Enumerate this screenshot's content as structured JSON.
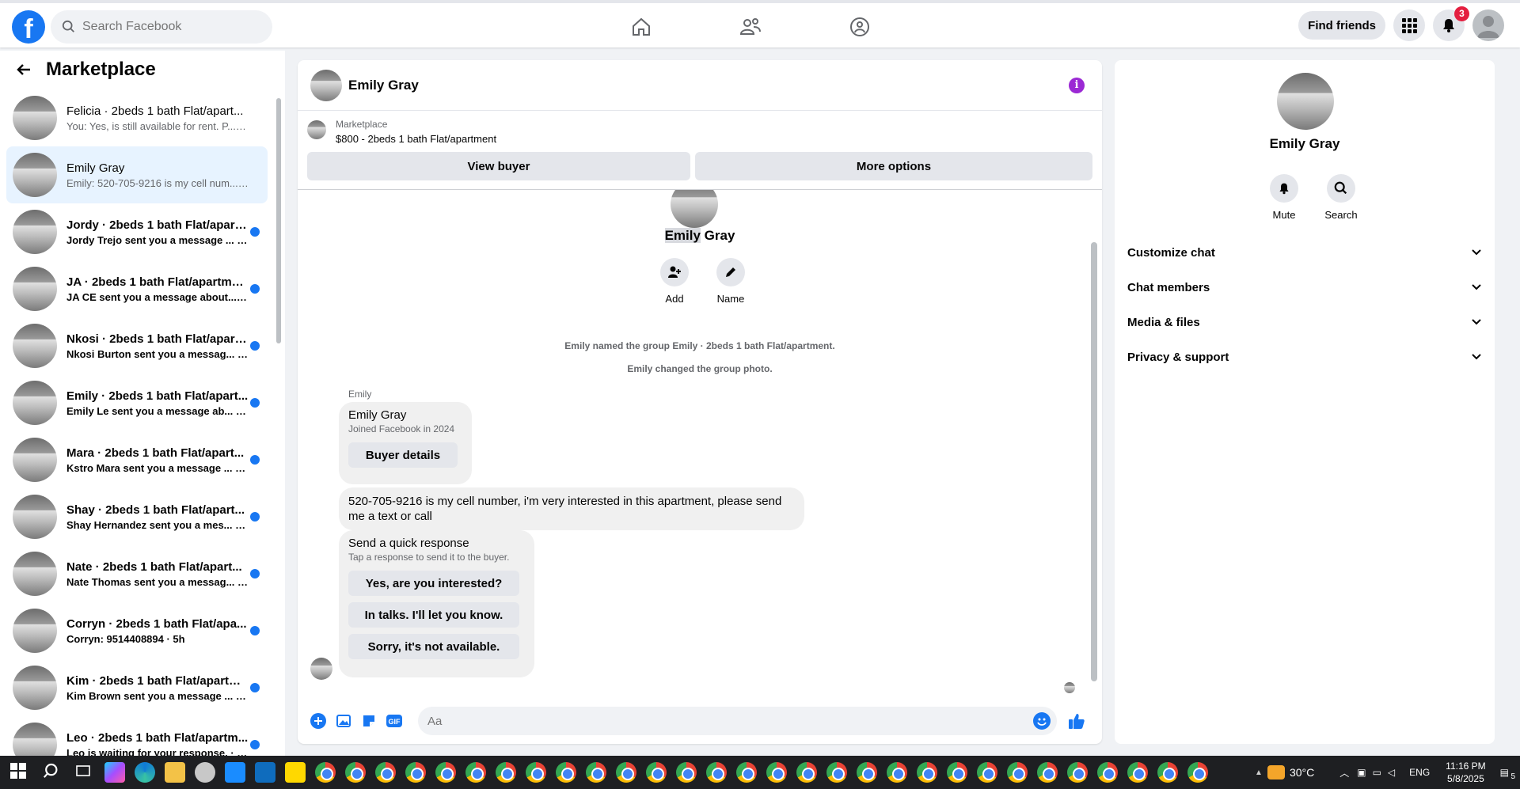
{
  "nav": {
    "search_placeholder": "Search Facebook",
    "find_friends": "Find friends",
    "notifications_count": "3"
  },
  "sidebar": {
    "title": "Marketplace",
    "conversations": [
      {
        "name": "Felicia · 2beds 1 bath Flat/apart...",
        "preview": "You: Yes, is still available for rent. P...",
        "time": "6m",
        "unread": false
      },
      {
        "name": "Emily Gray",
        "preview": "Emily: 520-705-9216 is my cell num...",
        "time": "1h",
        "unread": false
      },
      {
        "name": "Jordy · 2beds 1 bath Flat/apart...",
        "preview": "Jordy Trejo sent you a message ...",
        "time": "2h",
        "unread": true
      },
      {
        "name": "JA · 2beds 1 bath Flat/apartment",
        "preview": "JA CE sent you a message about...",
        "time": "3h",
        "unread": true
      },
      {
        "name": "Nkosi · 2beds 1 bath Flat/apart...",
        "preview": "Nkosi Burton sent you a messag...",
        "time": "3h",
        "unread": true
      },
      {
        "name": "Emily · 2beds 1 bath Flat/apart...",
        "preview": "Emily Le sent you a message ab...",
        "time": "4h",
        "unread": true
      },
      {
        "name": "Mara · 2beds 1 bath Flat/apart...",
        "preview": "Kstro Mara sent you a message ...",
        "time": "4h",
        "unread": true
      },
      {
        "name": "Shay · 2beds 1 bath Flat/apart...",
        "preview": "Shay Hernandez sent you a mes...",
        "time": "4h",
        "unread": true
      },
      {
        "name": "Nate · 2beds 1 bath Flat/apart...",
        "preview": "Nate Thomas sent you a messag...",
        "time": "4h",
        "unread": true
      },
      {
        "name": "Corryn · 2beds 1 bath Flat/apa...",
        "preview": "Corryn: 9514408894",
        "time": "5h",
        "unread": true
      },
      {
        "name": "Kim · 2beds 1 bath Flat/apartm...",
        "preview": "Kim Brown sent you a message ...",
        "time": "5h",
        "unread": true
      },
      {
        "name": "Leo · 2beds 1 bath Flat/apartm...",
        "preview": "Leo is waiting for your response.",
        "time": "6h",
        "unread": true
      }
    ]
  },
  "chat": {
    "title": "Emily Gray",
    "marketplace_label": "Marketplace",
    "listing": "$800 - 2beds 1 bath Flat/apartment",
    "view_buyer": "View buyer",
    "more_options": "More options",
    "center_name_first": "Emily",
    "center_name_last": "Gray",
    "add_label": "Add",
    "name_label": "Name",
    "system_msg_1": "Emily named the group Emily · 2beds 1 bath Flat/apartment.",
    "system_msg_2": "Emily changed the group photo.",
    "sender": "Emily",
    "card_name": "Emily Gray",
    "card_joined": "Joined Facebook in 2024",
    "buyer_details": "Buyer details",
    "message": "520-705-9216 is my cell number, i'm very interested in this apartment, please send me a text or call",
    "quick_title": "Send a quick response",
    "quick_sub": "Tap a response to send it to the buyer.",
    "quick_replies": [
      "Yes, are you interested?",
      "In talks. I'll let you know.",
      "Sorry, it's not available."
    ],
    "input_placeholder": "Aa"
  },
  "right_panel": {
    "name": "Emily Gray",
    "mute": "Mute",
    "search": "Search",
    "rows": [
      "Customize chat",
      "Chat members",
      "Media & files",
      "Privacy & support"
    ]
  },
  "taskbar": {
    "weather": "30°C",
    "lang": "ENG",
    "time": "11:16 PM",
    "date": "5/8/2025",
    "notif_count": "5"
  },
  "colors": {
    "brand": "#1877f2",
    "info": "#9b29d4",
    "badge": "#e41e3f"
  }
}
